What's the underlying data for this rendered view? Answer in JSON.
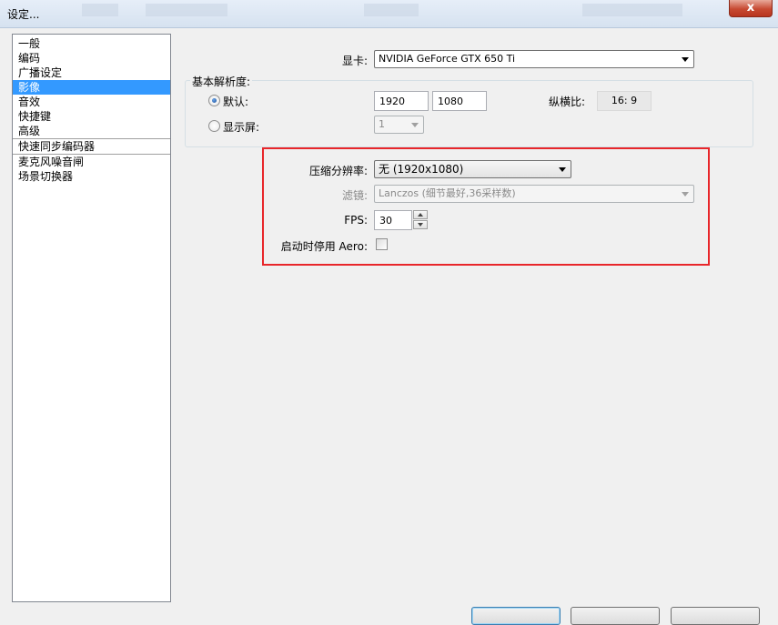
{
  "window": {
    "title": "设定...",
    "close_glyph": "x"
  },
  "sidebar": {
    "items": [
      {
        "label": "一般"
      },
      {
        "label": "编码"
      },
      {
        "label": "广播设定"
      },
      {
        "label": "影像",
        "selected": true
      },
      {
        "label": "音效"
      },
      {
        "label": "快捷键"
      },
      {
        "label": "高级"
      },
      {
        "label": "快速同步编码器"
      },
      {
        "label": "麦克风噪音闸"
      },
      {
        "label": "场景切换器"
      }
    ]
  },
  "video": {
    "gpu_label": "显卡:",
    "gpu_value": "NVIDIA GeForce GTX 650 Ti",
    "base_res_group_title": "基本解析度:",
    "default_radio_label": "默认:",
    "width_value": "1920",
    "height_value": "1080",
    "aspect_label": "纵横比:",
    "aspect_value": "16: 9",
    "monitor_radio_label": "显示屏:",
    "monitor_value": "1",
    "downscale_label": "压缩分辨率:",
    "downscale_value": "无 (1920x1080)",
    "filter_label": "滤镜:",
    "filter_value": "Lanczos (细节最好,36采样数)",
    "fps_label": "FPS:",
    "fps_value": "30",
    "aero_label": "启动时停用 Aero:"
  },
  "colors": {
    "selection": "#3399ff",
    "annotation_frame": "#e8262a",
    "close_button": "#c74a32"
  }
}
